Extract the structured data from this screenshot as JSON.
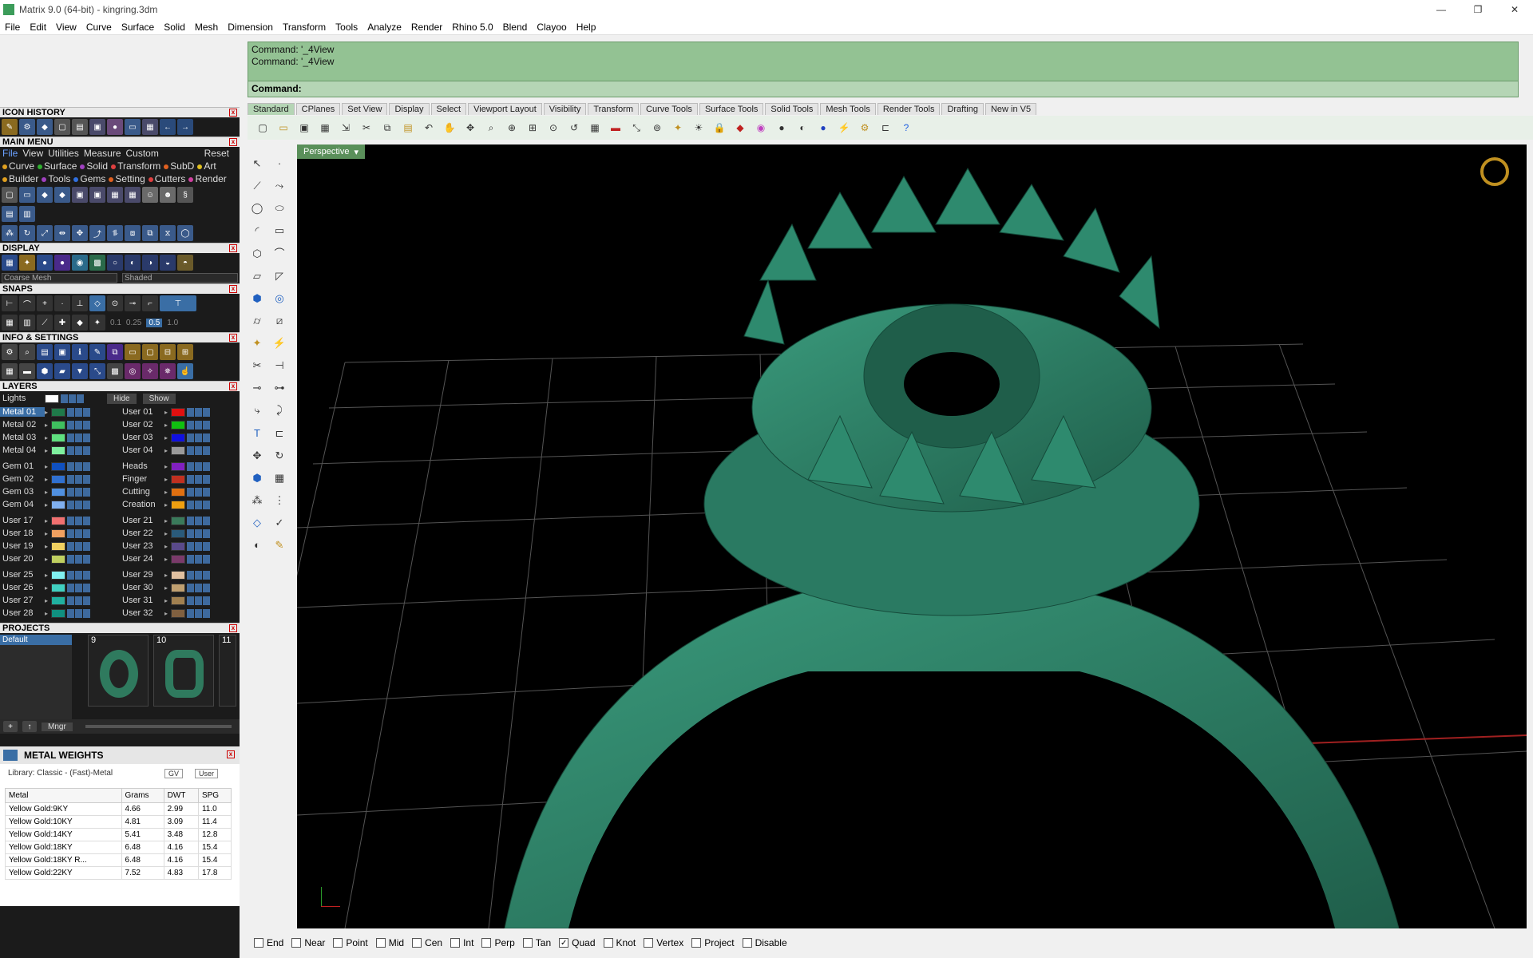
{
  "app": {
    "title": "Matrix 9.0 (64-bit) - kingring.3dm"
  },
  "window_controls": [
    "—",
    "❐",
    "✕"
  ],
  "menu": [
    "File",
    "Edit",
    "View",
    "Curve",
    "Surface",
    "Solid",
    "Mesh",
    "Dimension",
    "Transform",
    "Tools",
    "Analyze",
    "Render",
    "Rhino 5.0",
    "Blend",
    "Clayoo",
    "Help"
  ],
  "command": {
    "history": [
      "Command: '_4View",
      "Command: '_4View"
    ],
    "prompt": "Command:"
  },
  "tabs": [
    "Standard",
    "CPlanes",
    "Set View",
    "Display",
    "Select",
    "Viewport Layout",
    "Visibility",
    "Transform",
    "Curve Tools",
    "Surface Tools",
    "Solid Tools",
    "Mesh Tools",
    "Render Tools",
    "Drafting",
    "New in V5"
  ],
  "viewport": {
    "label": "Perspective"
  },
  "panels": {
    "icon_history": "ICON HISTORY",
    "main_menu": {
      "title": "MAIN MENU",
      "tabs": [
        "File",
        "View",
        "Utilities",
        "Measure",
        "Custom",
        "Reset"
      ],
      "row1": [
        "Curve",
        "Surface",
        "Solid",
        "Transform",
        "SubD",
        "Art"
      ],
      "row2": [
        "Builder",
        "Tools",
        "Gems",
        "Setting",
        "Cutters",
        "Render"
      ]
    },
    "display": {
      "title": "DISPLAY",
      "mesh": "Coarse Mesh",
      "mode": "Shaded"
    },
    "snaps": {
      "title": "SNAPS",
      "values": [
        "0.1",
        "0.25",
        "0.5",
        "1.0"
      ]
    },
    "info": "INFO & SETTINGS",
    "layers": {
      "title": "LAYERS",
      "lights": "Lights",
      "hide": "Hide",
      "show": "Show",
      "groups": [
        {
          "left": [
            "Metal 01",
            "Metal 02",
            "Metal 03",
            "Metal 04"
          ],
          "right": [
            "User 01",
            "User 02",
            "User 03",
            "User 04"
          ],
          "lcol": [
            "#1f7a4a",
            "#3fbf5f",
            "#5fe07f",
            "#7ff09f"
          ],
          "rcol": [
            "#e01010",
            "#10c010",
            "#1010e0",
            "#9a9a9a"
          ]
        },
        {
          "left": [
            "Gem 01",
            "Gem 02",
            "Gem 03",
            "Gem 04"
          ],
          "right": [
            "Heads",
            "Finger",
            "Cutting",
            "Creation"
          ],
          "lcol": [
            "#1050c0",
            "#3070d0",
            "#5090e0",
            "#80b0f0"
          ],
          "rcol": [
            "#8020c0",
            "#c03020",
            "#e07010",
            "#f0a010"
          ]
        },
        {
          "left": [
            "User 17",
            "User 18",
            "User 19",
            "User 20"
          ],
          "right": [
            "User 21",
            "User 22",
            "User 23",
            "User 24"
          ],
          "lcol": [
            "#f07070",
            "#f0a060",
            "#f0d060",
            "#c0d060"
          ],
          "rcol": [
            "#3a7a5a",
            "#2a5a7a",
            "#5a4a8a",
            "#7a3a6a"
          ]
        },
        {
          "left": [
            "User 25",
            "User 26",
            "User 27",
            "User 28"
          ],
          "right": [
            "User 29",
            "User 30",
            "User 31",
            "User 32"
          ],
          "lcol": [
            "#80f0f0",
            "#40d0c0",
            "#20b0a0",
            "#109080"
          ],
          "rcol": [
            "#e0c0a0",
            "#c0a070",
            "#a08050",
            "#806040"
          ]
        }
      ]
    },
    "projects": {
      "title": "PROJECTS",
      "list": [
        "Default"
      ],
      "thumbs": [
        "9",
        "10",
        "11"
      ],
      "manager": "Mngr"
    },
    "metal_weights": {
      "title": "METAL WEIGHTS",
      "library": "Library: Classic - (Fast)-Metal",
      "gv": "GV",
      "user": "User",
      "columns": [
        "Metal",
        "Grams",
        "DWT",
        "SPG"
      ],
      "rows": [
        [
          "Yellow Gold:9KY",
          "4.66",
          "2.99",
          "11.0"
        ],
        [
          "Yellow Gold:10KY",
          "4.81",
          "3.09",
          "11.4"
        ],
        [
          "Yellow Gold:14KY",
          "5.41",
          "3.48",
          "12.8"
        ],
        [
          "Yellow Gold:18KY",
          "6.48",
          "4.16",
          "15.4"
        ],
        [
          "Yellow Gold:18KY R...",
          "6.48",
          "4.16",
          "15.4"
        ],
        [
          "Yellow Gold:22KY",
          "7.52",
          "4.83",
          "17.8"
        ]
      ]
    }
  },
  "osnaps": [
    {
      "label": "End",
      "checked": false
    },
    {
      "label": "Near",
      "checked": false
    },
    {
      "label": "Point",
      "checked": false
    },
    {
      "label": "Mid",
      "checked": false
    },
    {
      "label": "Cen",
      "checked": false
    },
    {
      "label": "Int",
      "checked": false
    },
    {
      "label": "Perp",
      "checked": false
    },
    {
      "label": "Tan",
      "checked": false
    },
    {
      "label": "Quad",
      "checked": true
    },
    {
      "label": "Knot",
      "checked": false
    },
    {
      "label": "Vertex",
      "checked": false
    },
    {
      "label": "Project",
      "checked": false
    },
    {
      "label": "Disable",
      "checked": false
    }
  ]
}
